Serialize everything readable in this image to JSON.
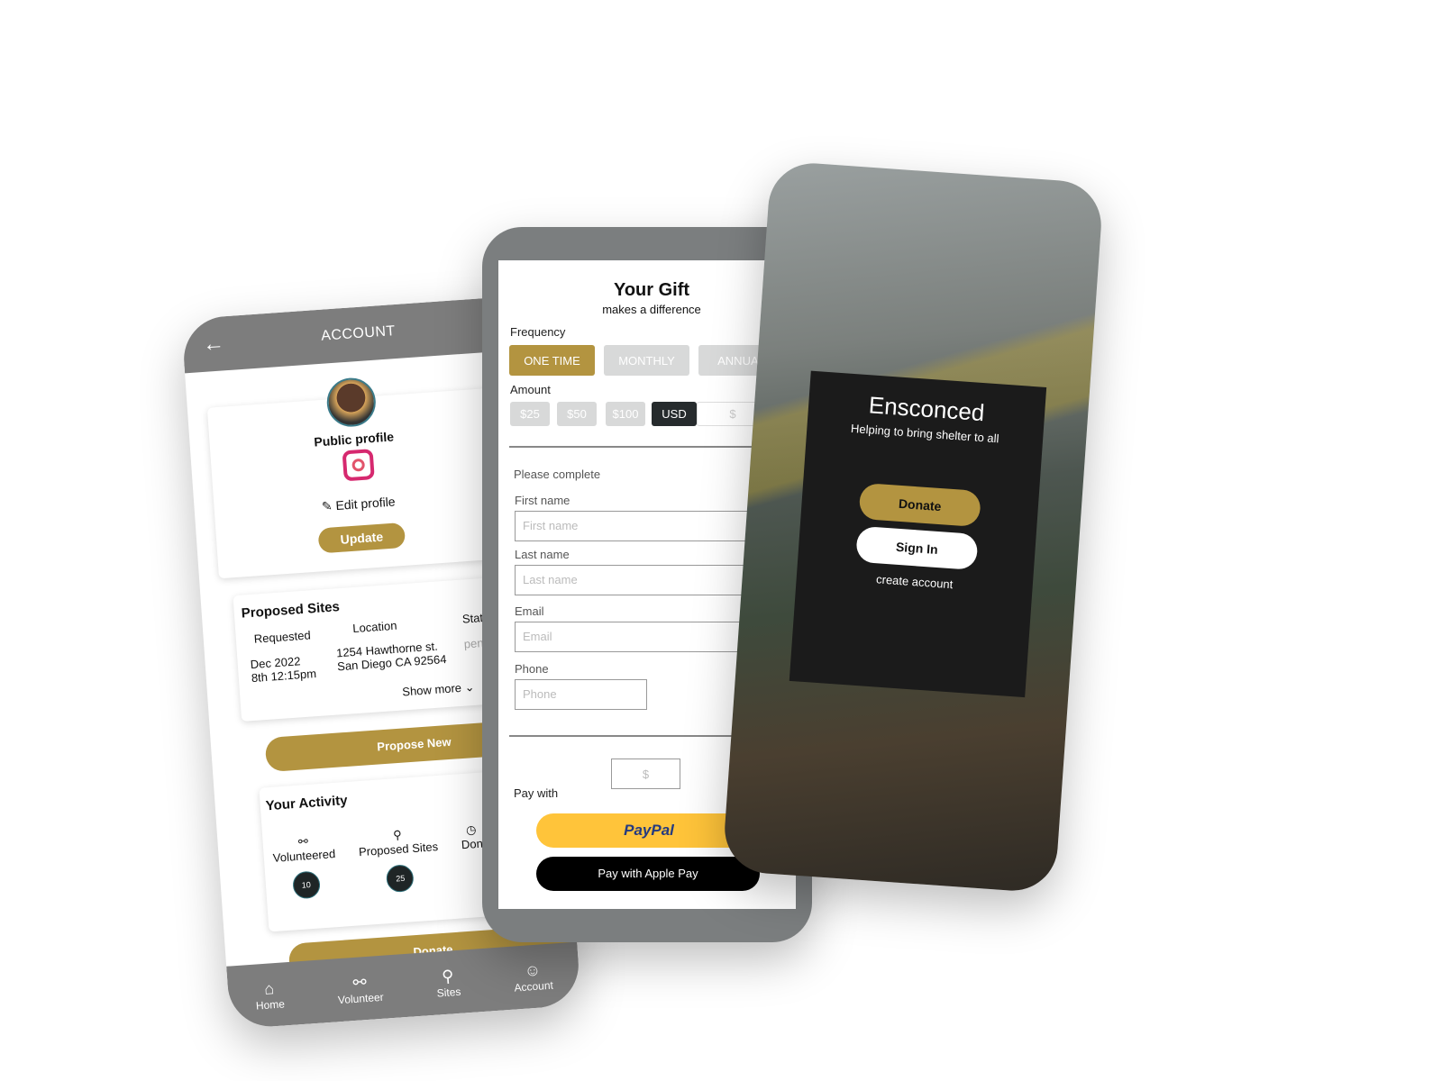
{
  "account": {
    "title": "ACCOUNT",
    "public_profile": "Public profile",
    "edit_profile": "Edit profile",
    "update": "Update",
    "proposed_title": "Proposed Sites",
    "cols": [
      "Requested",
      "Location",
      "Stat"
    ],
    "row": {
      "date1": "Dec 2022",
      "date2": "8th 12:15pm",
      "loc1": "1254 Hawthorne st.",
      "loc2": "San Diego CA 92564",
      "status": "pend"
    },
    "show_more": "Show more",
    "propose_new": "Propose New",
    "activity_title": "Your Activity",
    "activity": [
      {
        "label": "Volunteered",
        "count": "10",
        "icon": "people-icon"
      },
      {
        "label": "Proposed Sites",
        "count": "25",
        "icon": "pin-icon"
      },
      {
        "label": "Don",
        "count": "",
        "icon": "clock-icon"
      }
    ],
    "donate": "Donate",
    "nav": [
      {
        "label": "Home",
        "icon": "home-icon"
      },
      {
        "label": "Volunteer",
        "icon": "people-icon"
      },
      {
        "label": "Sites",
        "icon": "pin-icon"
      },
      {
        "label": "Account",
        "icon": "user-icon"
      }
    ]
  },
  "gift": {
    "title": "Your Gift",
    "subtitle": "makes a difference",
    "frequency": "Frequency",
    "freq_options": [
      "ONE TIME",
      "MONTHLY",
      "ANNUAL"
    ],
    "selected_frequency": "ONE TIME",
    "amount": "Amount",
    "amounts": [
      "$25",
      "$50",
      "$100"
    ],
    "currency": "USD",
    "amount_placeholder": "$",
    "please_complete": "Please complete",
    "fields": [
      {
        "label": "First name",
        "placeholder": "First name"
      },
      {
        "label": "Last name",
        "placeholder": "Last name"
      },
      {
        "label": "Email",
        "placeholder": "Email"
      },
      {
        "label": "Phone",
        "placeholder": "Phone"
      }
    ],
    "total_placeholder": "$",
    "pay_with": "Pay with",
    "paypal": "PayPal",
    "apple_pay": "Pay with Apple Pay"
  },
  "landing": {
    "brand": "Ensconced",
    "tagline": "Helping to bring shelter to all",
    "donate": "Donate",
    "sign_in": "Sign In",
    "create_account": "create account"
  },
  "colors": {
    "gold": "#b39440",
    "gray": "#7d7d7d",
    "paypal": "#ffc43a",
    "dark": "#1b1b1b"
  }
}
